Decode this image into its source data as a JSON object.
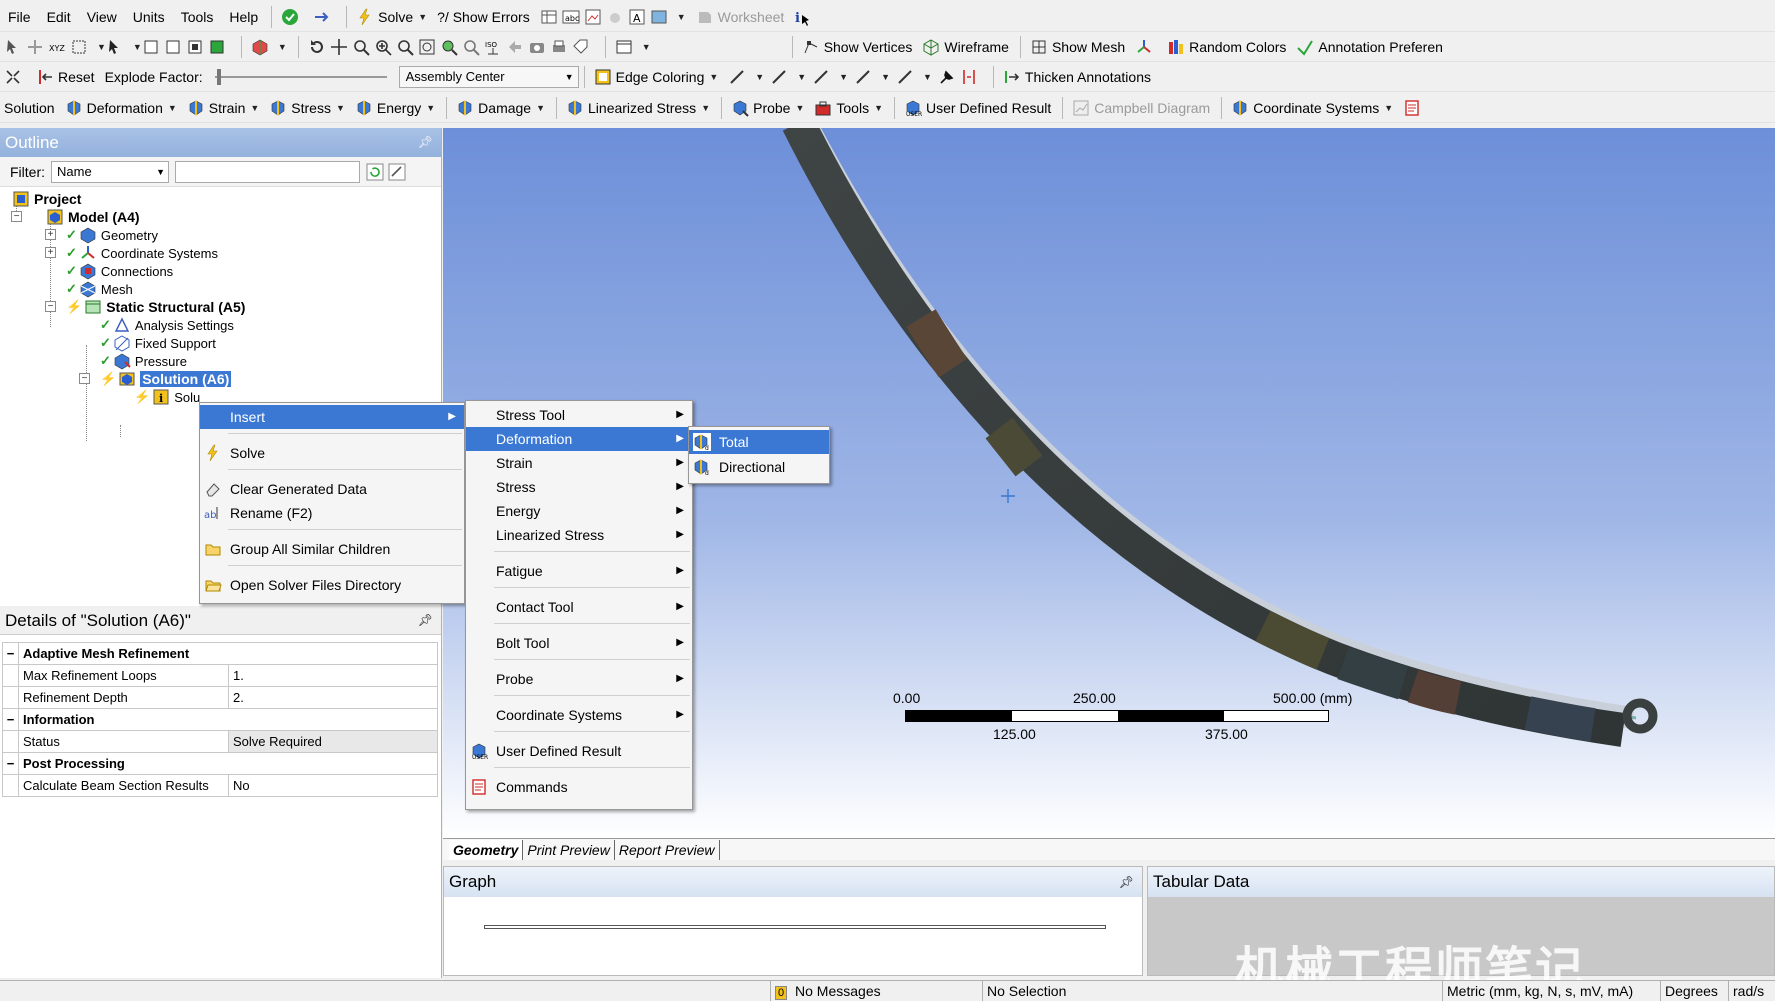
{
  "menubar": [
    "File",
    "Edit",
    "View",
    "Units",
    "Tools",
    "Help"
  ],
  "toolbar1": {
    "solve": "Solve",
    "show_errors": "?/ Show Errors",
    "worksheet": "Worksheet"
  },
  "toolbar2": {
    "show_vertices": "Show Vertices",
    "wireframe": "Wireframe",
    "show_mesh": "Show Mesh",
    "random_colors": "Random Colors",
    "annotation_prefs": "Annotation Preferen"
  },
  "toolbar3": {
    "reset": "Reset",
    "explode_factor": "Explode Factor:",
    "assembly_center": "Assembly Center",
    "edge_coloring": "Edge Coloring",
    "thicken_annotations": "Thicken Annotations"
  },
  "toolbar4": {
    "solution": "Solution",
    "deformation": "Deformation",
    "strain": "Strain",
    "stress": "Stress",
    "energy": "Energy",
    "damage": "Damage",
    "linearized_stress": "Linearized Stress",
    "probe": "Probe",
    "tools": "Tools",
    "user_defined_result": "User Defined Result",
    "campbell_diagram": "Campbell Diagram",
    "coordinate_systems": "Coordinate Systems"
  },
  "outline": {
    "title": "Outline",
    "filter_label": "Filter:",
    "filter_value": "Name",
    "tree": {
      "project": "Project",
      "model": "Model (A4)",
      "geometry": "Geometry",
      "coordinate_systems": "Coordinate Systems",
      "connections": "Connections",
      "mesh": "Mesh",
      "static_structural": "Static Structural (A5)",
      "analysis_settings": "Analysis Settings",
      "fixed_support": "Fixed Support",
      "pressure": "Pressure",
      "solution": "Solution (A6)",
      "solution_info": "Solu"
    }
  },
  "details": {
    "title": "Details of \"Solution (A6)\"",
    "groups": [
      {
        "name": "Adaptive Mesh Refinement",
        "rows": [
          {
            "key": "Max Refinement Loops",
            "value": "1."
          },
          {
            "key": "Refinement Depth",
            "value": "2."
          }
        ]
      },
      {
        "name": "Information",
        "rows": [
          {
            "key": "Status",
            "value": "Solve Required"
          }
        ]
      },
      {
        "name": "Post Processing",
        "rows": [
          {
            "key": "Calculate Beam Section Results",
            "value": "No"
          }
        ]
      }
    ]
  },
  "context_menu": {
    "insert": "Insert",
    "solve": "Solve",
    "clear_generated_data": "Clear Generated Data",
    "rename": "Rename (F2)",
    "group_all_similar_children": "Group All Similar Children",
    "open_solver_files_directory": "Open Solver Files Directory"
  },
  "insert_submenu": {
    "stress_tool": "Stress Tool",
    "deformation": "Deformation",
    "strain": "Strain",
    "stress": "Stress",
    "energy": "Energy",
    "linearized_stress": "Linearized Stress",
    "fatigue": "Fatigue",
    "contact_tool": "Contact Tool",
    "bolt_tool": "Bolt Tool",
    "probe": "Probe",
    "coordinate_systems": "Coordinate Systems",
    "user_defined_result": "User Defined Result",
    "commands": "Commands"
  },
  "deformation_submenu": {
    "total": "Total",
    "directional": "Directional"
  },
  "scale_bar": {
    "top_labels": [
      "0.00",
      "250.00",
      "500.00 (mm)"
    ],
    "bottom_labels": [
      "125.00",
      "375.00"
    ]
  },
  "view_tabs": [
    "Geometry",
    "Print Preview",
    "Report Preview"
  ],
  "graph_title": "Graph",
  "tabular_title": "Tabular Data",
  "status": {
    "messages": "No Messages",
    "messages_count": "0",
    "selection": "No Selection",
    "units": "Metric (mm, kg, N, s, mV, mA)",
    "angle": "Degrees",
    "rate": "rad/s"
  },
  "watermark": "机械工程师笔记",
  "colors": {
    "selection_blue": "#3a78d4",
    "panel_title_blue": "#93b1dc",
    "spring_dark": "#3b4040"
  }
}
